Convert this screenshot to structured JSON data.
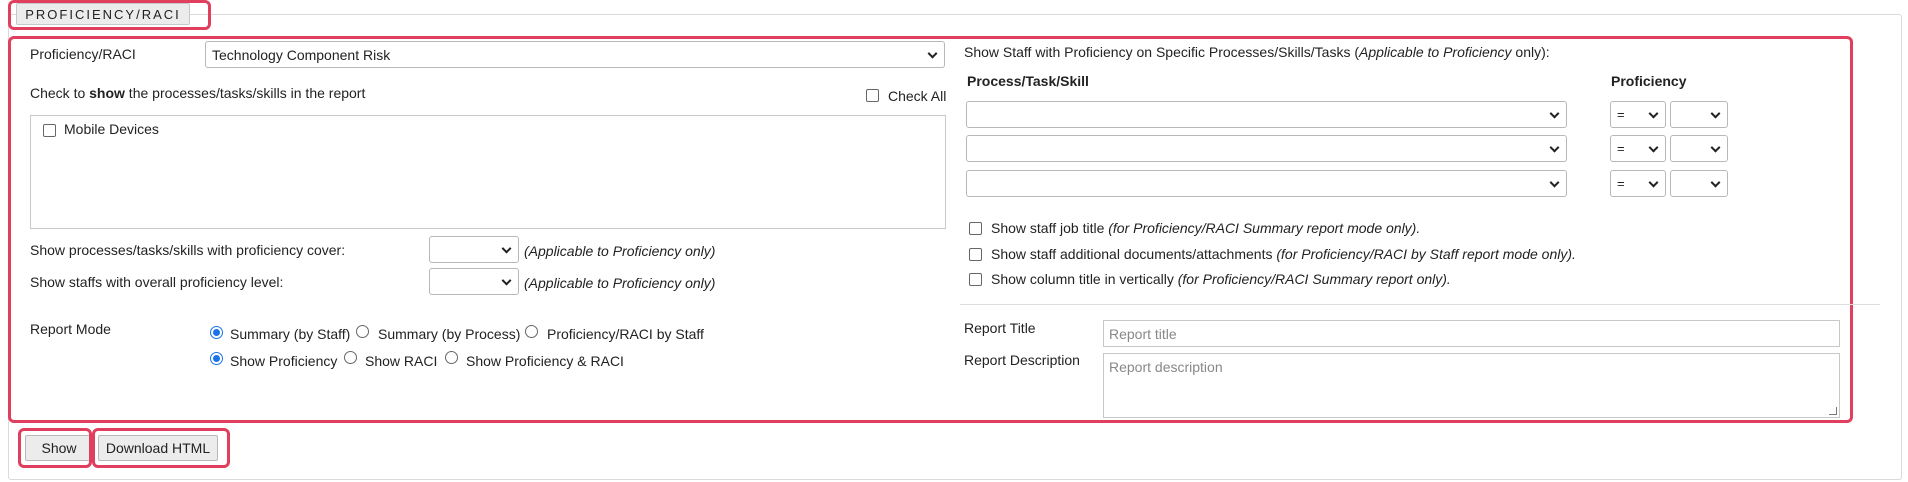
{
  "section": {
    "legend": "PROFICIENCY/RACI"
  },
  "left": {
    "proficiency_label": "Proficiency/RACI",
    "proficiency_value": "Technology Component Risk",
    "check_text_pre": "Check to ",
    "check_text_bold": "show",
    "check_text_post": " the processes/tasks/skills in the report",
    "check_all_label": "Check All",
    "items": [
      {
        "label": "Mobile Devices"
      }
    ],
    "cover_label": "Show processes/tasks/skills with proficiency cover:",
    "cover_note": "(Applicable to Proficiency only)",
    "level_label": "Show staffs with overall proficiency level:",
    "level_note": "(Applicable to Proficiency only)",
    "report_mode_label": "Report Mode",
    "mode_options": [
      "Summary (by Staff)",
      "Summary (by Process)",
      "Proficiency/RACI by Staff"
    ],
    "show_options": [
      "Show Proficiency",
      "Show RACI",
      "Show Proficiency & RACI"
    ]
  },
  "right": {
    "intro": "Show Staff with Proficiency on Specific Processes/Skills/Tasks (",
    "intro_note": "Applicable to Proficiency",
    "intro_end": " only):",
    "col_process": "Process/Task/Skill",
    "col_proficiency": "Proficiency",
    "operator": "=",
    "options": [
      {
        "label": "Show staff job title ",
        "note": "(for Proficiency/RACI Summary report mode only)."
      },
      {
        "label": "Show staff additional documents/attachments ",
        "note": "(for Proficiency/RACI by Staff report mode only)."
      },
      {
        "label": "Show column title in vertically ",
        "note": "(for Proficiency/RACI Summary report only)."
      }
    ],
    "report_title_label": "Report Title",
    "report_title_placeholder": "Report title",
    "report_desc_label": "Report Description",
    "report_desc_placeholder": "Report description"
  },
  "buttons": {
    "show": "Show",
    "download": "Download HTML"
  },
  "colors": {
    "highlight": "#e0405e",
    "radio_checked": "#1a73e8"
  }
}
